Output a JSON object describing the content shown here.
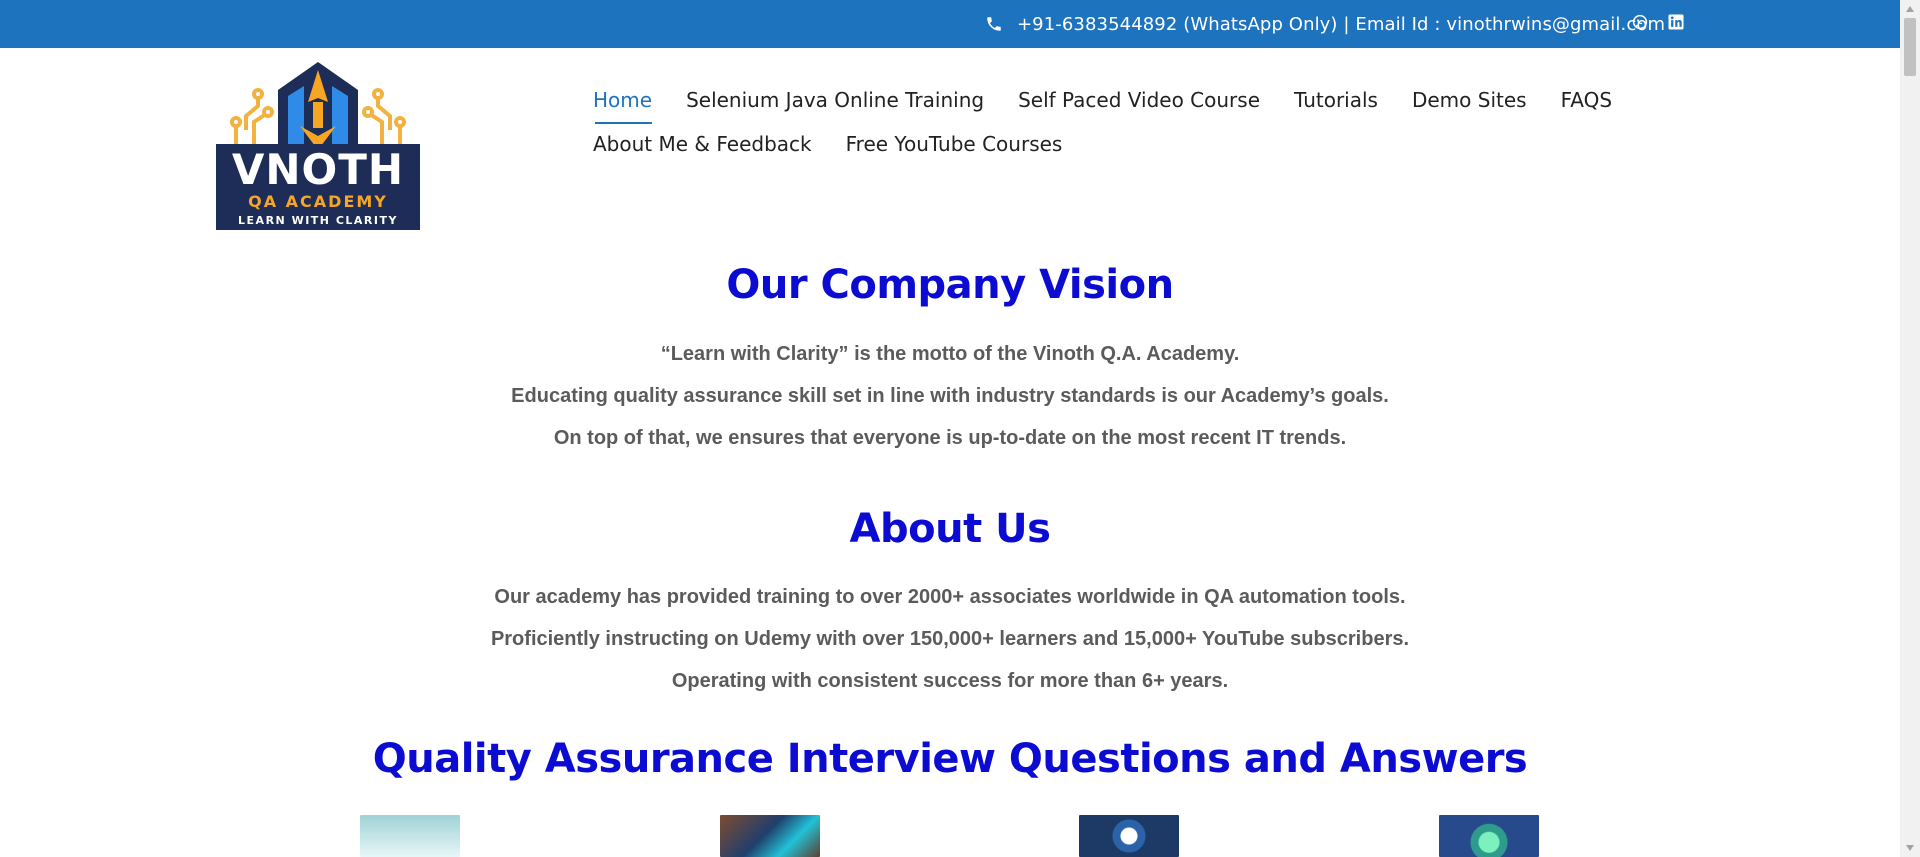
{
  "topbar": {
    "contact_text": "+91-6383544892 (WhatsApp Only) | Email Id : vinothrwins@gmail.com",
    "phone_icon": "phone-icon",
    "social_icons": [
      "whatsapp-icon",
      "linkedin-icon"
    ]
  },
  "logo": {
    "brand_name": "VNOTH",
    "academy": "QA ACADEMY",
    "tagline": "LEARN WITH CLARITY"
  },
  "nav": {
    "items": [
      {
        "label": "Home",
        "active": true
      },
      {
        "label": "Selenium Java Online Training"
      },
      {
        "label": "Self Paced Video Course"
      },
      {
        "label": "Tutorials"
      },
      {
        "label": "Demo Sites"
      },
      {
        "label": "FAQS"
      },
      {
        "label": "About Me & Feedback"
      },
      {
        "label": "Free YouTube Courses"
      }
    ]
  },
  "vision": {
    "title": "Our Company Vision",
    "lines": [
      "“Learn with Clarity” is the motto of the Vinoth Q.A. Academy.",
      "Educating quality assurance skill set in line with industry standards is our Academy’s goals.",
      "On top of that, we ensures that everyone is up-to-date on the most recent IT trends."
    ]
  },
  "about": {
    "title": "About Us",
    "lines": [
      "Our academy has provided training to over 2000+ associates worldwide in QA automation tools.",
      "Proficiently instructing on Udemy with over 150,000+ learners and 15,000+ YouTube subscribers.",
      "Operating with consistent success for more than 6+ years."
    ]
  },
  "qa_section": {
    "title": "Quality Assurance Interview Questions and Answers"
  },
  "colors": {
    "topbar": "#1e73be",
    "heading": "#0b0bd1",
    "body_text": "#5b5b5b",
    "active_nav": "#1e73be"
  }
}
